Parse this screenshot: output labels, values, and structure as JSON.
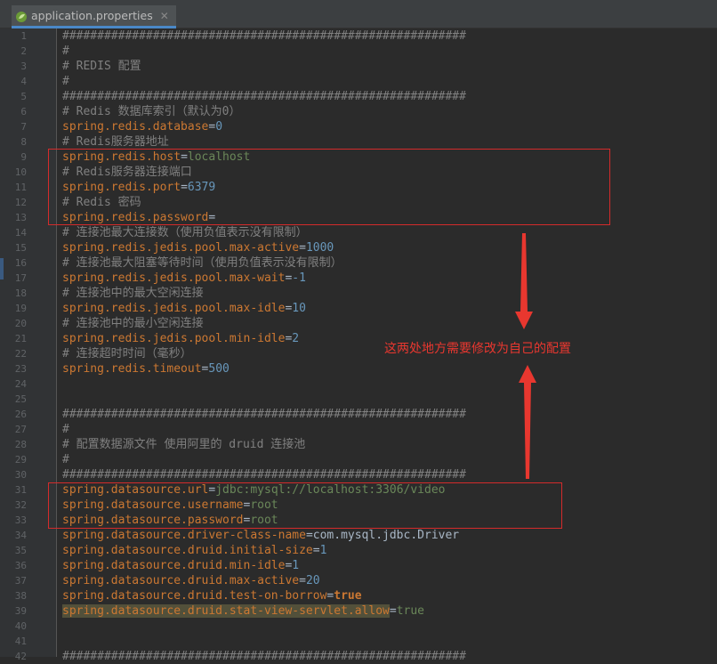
{
  "tab": {
    "title": "application.properties",
    "close": "✕"
  },
  "annotation": {
    "text": "这两处地方需要修改为自己的配置",
    "color": "#e8372f"
  },
  "colors": {
    "key": "#cc7832",
    "value": "#6a8759",
    "number": "#6897bb",
    "comment": "#808080",
    "highlight": "#52503a"
  },
  "lines": [
    {
      "n": "1",
      "k": "",
      "s": "",
      "v": "",
      "c": "##########################################################"
    },
    {
      "n": "2",
      "k": "",
      "s": "",
      "v": "",
      "c": "#"
    },
    {
      "n": "3",
      "k": "",
      "s": "",
      "v": "",
      "c": "# REDIS 配置"
    },
    {
      "n": "4",
      "k": "",
      "s": "",
      "v": "",
      "c": "#"
    },
    {
      "n": "5",
      "k": "",
      "s": "",
      "v": "",
      "c": "##########################################################"
    },
    {
      "n": "6",
      "k": "",
      "s": "",
      "v": "",
      "c": "# Redis 数据库索引（默认为0）"
    },
    {
      "n": "7",
      "k": "spring.redis.database",
      "s": "=",
      "v": "0",
      "t": "n"
    },
    {
      "n": "8",
      "k": "",
      "s": "",
      "v": "",
      "c": "# Redis服务器地址"
    },
    {
      "n": "9",
      "k": "spring.redis.host",
      "s": "=",
      "v": "localhost",
      "t": "v"
    },
    {
      "n": "10",
      "k": "",
      "s": "",
      "v": "",
      "c": "# Redis服务器连接端口"
    },
    {
      "n": "11",
      "k": "spring.redis.port",
      "s": "=",
      "v": "6379",
      "t": "n"
    },
    {
      "n": "12",
      "k": "",
      "s": "",
      "v": "",
      "c": "# Redis 密码"
    },
    {
      "n": "13",
      "k": "spring.redis.password",
      "s": "=",
      "v": "",
      "t": "v"
    },
    {
      "n": "14",
      "k": "",
      "s": "",
      "v": "",
      "c": "# 连接池最大连接数（使用负值表示没有限制）"
    },
    {
      "n": "15",
      "k": "spring.redis.jedis.pool.max-active",
      "s": "=",
      "v": "1000",
      "t": "n"
    },
    {
      "n": "16",
      "k": "",
      "s": "",
      "v": "",
      "c": "# 连接池最大阻塞等待时间（使用负值表示没有限制）"
    },
    {
      "n": "17",
      "k": "spring.redis.jedis.pool.max-wait",
      "s": "=",
      "v": "-1",
      "t": "n"
    },
    {
      "n": "18",
      "k": "",
      "s": "",
      "v": "",
      "c": "# 连接池中的最大空闲连接"
    },
    {
      "n": "19",
      "k": "spring.redis.jedis.pool.max-idle",
      "s": "=",
      "v": "10",
      "t": "n"
    },
    {
      "n": "20",
      "k": "",
      "s": "",
      "v": "",
      "c": "# 连接池中的最小空闲连接"
    },
    {
      "n": "21",
      "k": "spring.redis.jedis.pool.min-idle",
      "s": "=",
      "v": "2",
      "t": "n"
    },
    {
      "n": "22",
      "k": "",
      "s": "",
      "v": "",
      "c": "# 连接超时时间（毫秒）"
    },
    {
      "n": "23",
      "k": "spring.redis.timeout",
      "s": "=",
      "v": "500",
      "t": "n"
    },
    {
      "n": "24",
      "k": "",
      "s": "",
      "v": "",
      "c": ""
    },
    {
      "n": "25",
      "k": "",
      "s": "",
      "v": "",
      "c": ""
    },
    {
      "n": "26",
      "k": "",
      "s": "",
      "v": "",
      "c": "##########################################################"
    },
    {
      "n": "27",
      "k": "",
      "s": "",
      "v": "",
      "c": "#"
    },
    {
      "n": "28",
      "k": "",
      "s": "",
      "v": "",
      "c": "# 配置数据源文件 使用阿里的 druid 连接池"
    },
    {
      "n": "29",
      "k": "",
      "s": "",
      "v": "",
      "c": "#"
    },
    {
      "n": "30",
      "k": "",
      "s": "",
      "v": "",
      "c": "##########################################################"
    },
    {
      "n": "31",
      "k": "spring.datasource.url",
      "s": "=",
      "v": "jdbc:mysql://localhost:3306/video",
      "t": "v"
    },
    {
      "n": "32",
      "k": "spring.datasource.username",
      "s": "=",
      "v": "root",
      "t": "v"
    },
    {
      "n": "33",
      "k": "spring.datasource.password",
      "s": "=",
      "v": "root",
      "t": "v"
    },
    {
      "n": "34",
      "k": "spring.datasource.driver-class-name",
      "s": "=",
      "v": "com.mysql.jdbc.Driver",
      "t": "p"
    },
    {
      "n": "35",
      "k": "spring.datasource.druid.initial-size",
      "s": "=",
      "v": "1",
      "t": "n"
    },
    {
      "n": "36",
      "k": "spring.datasource.druid.min-idle",
      "s": "=",
      "v": "1",
      "t": "n"
    },
    {
      "n": "37",
      "k": "spring.datasource.druid.max-active",
      "s": "=",
      "v": "20",
      "t": "n"
    },
    {
      "n": "38",
      "k": "spring.datasource.druid.test-on-borrow",
      "s": "=",
      "v": "true",
      "t": "b"
    },
    {
      "n": "39",
      "k": "spring.datasource.druid.stat-view-servlet.allow",
      "s": "=",
      "v": "true",
      "t": "v",
      "hl": true
    },
    {
      "n": "40",
      "k": "",
      "s": "",
      "v": "",
      "c": ""
    },
    {
      "n": "41",
      "k": "",
      "s": "",
      "v": "",
      "c": ""
    },
    {
      "n": "42",
      "k": "",
      "s": "",
      "v": "",
      "c": "##########################################################"
    }
  ]
}
